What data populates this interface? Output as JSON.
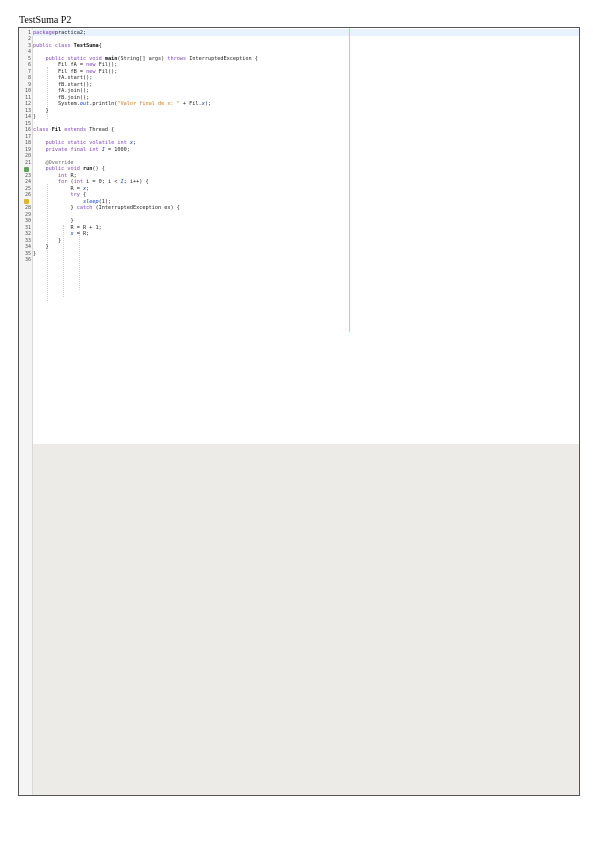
{
  "document": {
    "title": "TestSuma P2"
  },
  "editor": {
    "lines": [
      {
        "n": "1",
        "segs": [
          [
            "kw",
            "package"
          ],
          [
            "",
            "practica2;"
          ]
        ]
      },
      {
        "n": "2",
        "segs": []
      },
      {
        "n": "3",
        "segs": [
          [
            "kw",
            "public class "
          ],
          [
            "cls",
            "TestSuma"
          ],
          [
            "",
            "{"
          ]
        ]
      },
      {
        "n": "4",
        "segs": []
      },
      {
        "n": "5",
        "segs": [
          [
            "",
            "    "
          ],
          [
            "kw",
            "public static void "
          ],
          [
            "cls",
            "main"
          ],
          [
            "",
            "(String[] args) "
          ],
          [
            "kw",
            "throws "
          ],
          [
            "",
            "InterruptedException {"
          ]
        ]
      },
      {
        "n": "6",
        "segs": [
          [
            "",
            "        Fil fA = "
          ],
          [
            "kw",
            "new "
          ],
          [
            "",
            "Fil();"
          ]
        ]
      },
      {
        "n": "7",
        "segs": [
          [
            "",
            "        Fil fB = "
          ],
          [
            "kw",
            "new "
          ],
          [
            "",
            "Fil();"
          ]
        ]
      },
      {
        "n": "8",
        "segs": [
          [
            "",
            "        fA.start();"
          ]
        ]
      },
      {
        "n": "9",
        "segs": [
          [
            "",
            "        fB.start();"
          ]
        ]
      },
      {
        "n": "10",
        "segs": [
          [
            "",
            "        fA.join();"
          ]
        ]
      },
      {
        "n": "11",
        "segs": [
          [
            "",
            "        fB.join();"
          ]
        ]
      },
      {
        "n": "12",
        "segs": [
          [
            "",
            "        System."
          ],
          [
            "fld",
            "out"
          ],
          [
            "",
            ".println("
          ],
          [
            "str",
            "\"Valor final de x: \""
          ],
          [
            "",
            " + Fil."
          ],
          [
            "fld",
            "x"
          ],
          [
            "",
            ");"
          ]
        ]
      },
      {
        "n": "13",
        "segs": [
          [
            "",
            "    }"
          ]
        ]
      },
      {
        "n": "14",
        "segs": [
          [
            "",
            "}"
          ]
        ]
      },
      {
        "n": "15",
        "segs": []
      },
      {
        "n": "16",
        "segs": [
          [
            "kw",
            "class "
          ],
          [
            "cls",
            "Fil "
          ],
          [
            "kw",
            "extends "
          ],
          [
            "",
            "Thread {"
          ]
        ]
      },
      {
        "n": "17",
        "segs": []
      },
      {
        "n": "18",
        "segs": [
          [
            "",
            "    "
          ],
          [
            "kw",
            "public static volatile int "
          ],
          [
            "fld",
            "x"
          ],
          [
            "",
            ";"
          ]
        ]
      },
      {
        "n": "19",
        "segs": [
          [
            "",
            "    "
          ],
          [
            "kw",
            "private final int "
          ],
          [
            "fld",
            "I"
          ],
          [
            "",
            " = 1000;"
          ]
        ]
      },
      {
        "n": "20",
        "segs": []
      },
      {
        "n": "21",
        "segs": [
          [
            "",
            "    "
          ],
          [
            "ann",
            "@Override"
          ]
        ]
      },
      {
        "n": "22",
        "segs": [
          [
            "",
            "    "
          ],
          [
            "kw",
            "public void "
          ],
          [
            "cls",
            "run"
          ],
          [
            "",
            "() {"
          ]
        ]
      },
      {
        "n": "23",
        "segs": [
          [
            "",
            "        "
          ],
          [
            "kw",
            "int "
          ],
          [
            "",
            "R;"
          ]
        ]
      },
      {
        "n": "24",
        "segs": [
          [
            "",
            "        "
          ],
          [
            "kw",
            "for "
          ],
          [
            "",
            "("
          ],
          [
            "kw",
            "int "
          ],
          [
            "",
            "i = 0; i < "
          ],
          [
            "fld",
            "I"
          ],
          [
            "",
            "; i++) {"
          ]
        ]
      },
      {
        "n": "25",
        "segs": [
          [
            "",
            "            R = "
          ],
          [
            "fld",
            "x"
          ],
          [
            "",
            ";"
          ]
        ]
      },
      {
        "n": "26",
        "segs": [
          [
            "",
            "            "
          ],
          [
            "kw",
            "try "
          ],
          [
            "",
            "{"
          ]
        ]
      },
      {
        "n": "27",
        "segs": [
          [
            "",
            "                "
          ],
          [
            "fld",
            "sleep"
          ],
          [
            "",
            "(1);"
          ]
        ]
      },
      {
        "n": "28",
        "segs": [
          [
            "",
            "            } "
          ],
          [
            "kw",
            "catch "
          ],
          [
            "",
            "(InterruptedException ex) {"
          ]
        ]
      },
      {
        "n": "29",
        "segs": []
      },
      {
        "n": "30",
        "segs": [
          [
            "",
            "            }"
          ]
        ]
      },
      {
        "n": "31",
        "segs": [
          [
            "",
            "            R = R + 1;"
          ]
        ]
      },
      {
        "n": "32",
        "segs": [
          [
            "",
            "            "
          ],
          [
            "fld",
            "x"
          ],
          [
            "",
            " = R;"
          ]
        ]
      },
      {
        "n": "33",
        "segs": [
          [
            "",
            "        }"
          ]
        ]
      },
      {
        "n": "34",
        "segs": [
          [
            "",
            "    }"
          ]
        ]
      },
      {
        "n": "35",
        "segs": [
          [
            "",
            "}"
          ]
        ]
      },
      {
        "n": "36",
        "segs": []
      }
    ],
    "markers": {
      "22": "lock-icon",
      "27": "warn-icon"
    }
  }
}
